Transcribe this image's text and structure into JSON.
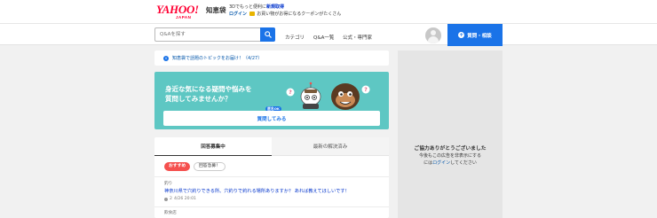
{
  "header": {
    "logo_main": "YAHOO!",
    "logo_sub": "JAPAN",
    "logo_service": "知恵袋",
    "promo_line1_prefix": "3Dでもっと便利に",
    "promo_line1_link": "新規取得",
    "promo_line2_login": "ログイン",
    "promo_line2_text": "お買い物がお得になるクーポンがたくさん",
    "search_placeholder": "Q&Aを探す",
    "nav": [
      "カテゴリ",
      "Q&A一覧",
      "公式・専門家"
    ],
    "ask_button": "質問・相談"
  },
  "notice": {
    "text": "知恵袋で話題のトピックをお届け！（4/27）"
  },
  "banner": {
    "line1": "身近な気になる疑問や悩みを",
    "line2": "質問してみませんか？",
    "badge": "匿名OK",
    "cta": "質問してみる"
  },
  "questions": {
    "tabs": [
      "回答募集中",
      "最新の解決済み"
    ],
    "chips": [
      "おすすめ",
      "回答急募！"
    ],
    "items": [
      {
        "category": "釣り",
        "title": "神奈川県で穴釣りできる所、穴釣りで釣れる場所ありますか？ あれば教えてほしいです！",
        "answers": "2",
        "datetime": "4/26 20:01"
      },
      {
        "category": "飲食店",
        "title": "",
        "answers": "",
        "datetime": ""
      }
    ]
  },
  "ad": {
    "title": "ご協力ありがとうございました",
    "line1": "今後もこの広告を非表示にする",
    "line2_prefix": "には",
    "line2_link": "ログイン",
    "line2_suffix": "してください"
  },
  "colors": {
    "brand_red": "#ff0033",
    "accent_blue": "#1a73e8",
    "banner_teal": "#5ec7c3",
    "chip_red": "#f5504e"
  },
  "icons": [
    "search-icon",
    "info-icon",
    "user-avatar-icon",
    "plus-icon",
    "answers-icon"
  ]
}
